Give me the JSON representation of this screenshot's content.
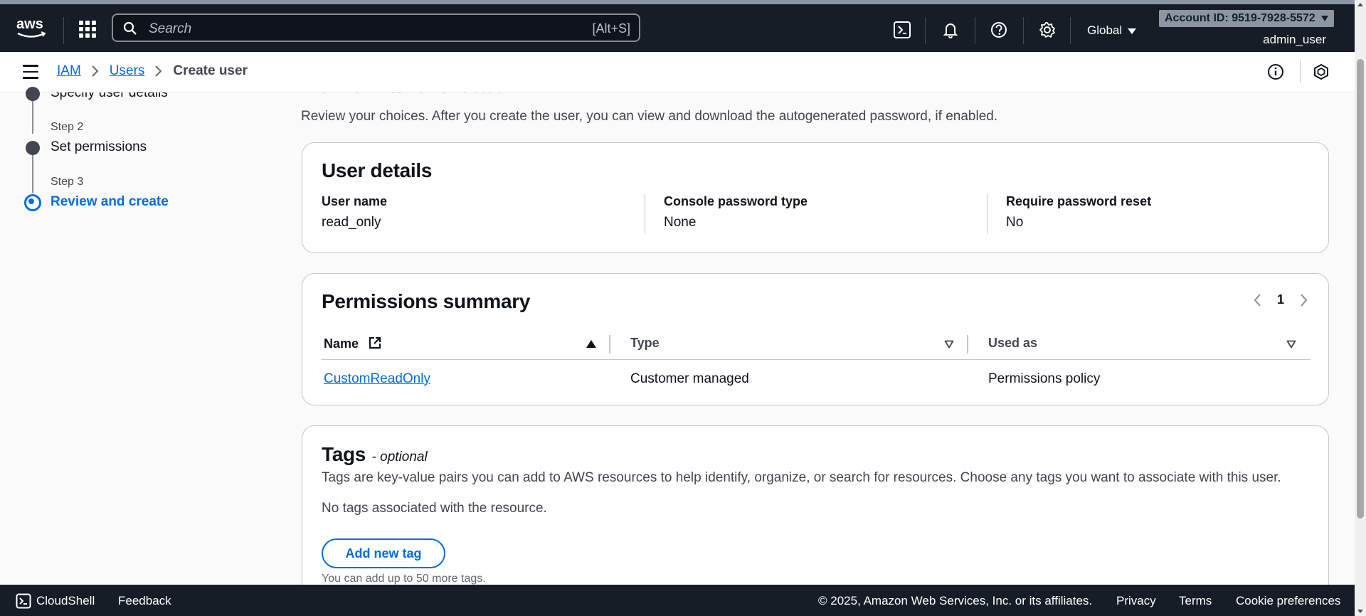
{
  "topnav": {
    "logo_text": "aws",
    "search_placeholder": "Search",
    "search_shortcut": "[Alt+S]",
    "region": "Global",
    "account": "Account ID: 9519-7928-5572",
    "user": "admin_user"
  },
  "breadcrumb": {
    "items": [
      "IAM",
      "Users",
      "Create user"
    ]
  },
  "steps": {
    "step1_label": "Specify user details",
    "step2_num": "Step 2",
    "step2_label": "Set permissions",
    "step3_num": "Step 3",
    "step3_label": "Review and create"
  },
  "page": {
    "title": "Review and create",
    "description": "Review your choices. After you create the user, you can view and download the autogenerated password, if enabled."
  },
  "user_details": {
    "title": "User details",
    "fields": [
      {
        "key": "User name",
        "value": "read_only"
      },
      {
        "key": "Console password type",
        "value": "None"
      },
      {
        "key": "Require password reset",
        "value": "No"
      }
    ]
  },
  "permissions": {
    "title": "Permissions summary",
    "page": "1",
    "columns": [
      "Name",
      "Type",
      "Used as"
    ],
    "rows": [
      {
        "name": "CustomReadOnly",
        "type": "Customer managed",
        "used_as": "Permissions policy"
      }
    ]
  },
  "tags": {
    "title": "Tags",
    "optional": "- optional",
    "description": "Tags are key-value pairs you can add to AWS resources to help identify, organize, or search for resources. Choose any tags you want to associate with this user.",
    "empty": "No tags associated with the resource.",
    "add_button": "Add new tag",
    "limit": "You can add up to 50 more tags."
  },
  "footer": {
    "cloudshell": "CloudShell",
    "feedback": "Feedback",
    "copyright": "© 2025, Amazon Web Services, Inc. or its affiliates.",
    "privacy": "Privacy",
    "terms": "Terms",
    "cookies": "Cookie preferences"
  },
  "colors": {
    "nav_bg": "#161d26",
    "link": "#006ce0",
    "text": "#0f141a"
  }
}
